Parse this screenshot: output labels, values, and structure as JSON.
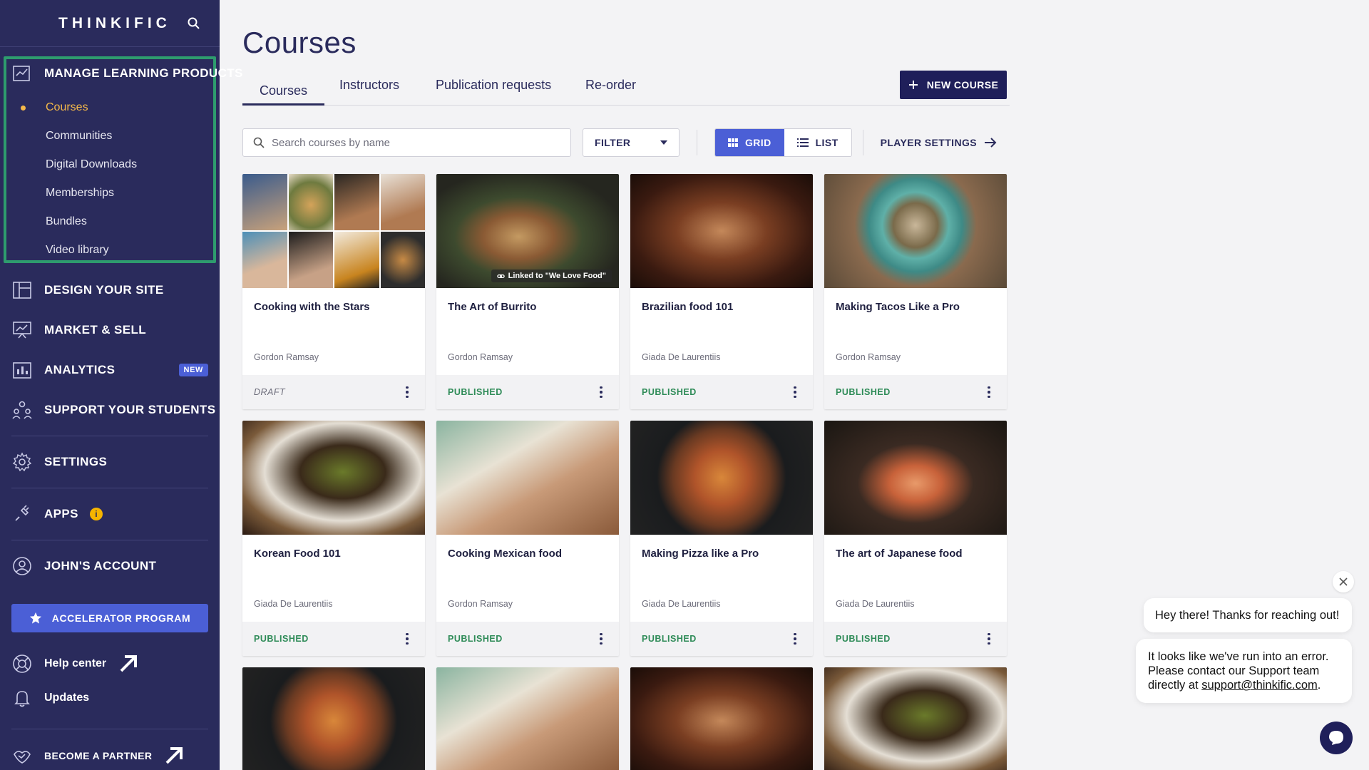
{
  "sidebar": {
    "logo": "THINKIFIC",
    "sections": {
      "manage": "MANAGE LEARNING PRODUCTS",
      "design": "DESIGN YOUR SITE",
      "market": "MARKET & SELL",
      "analytics": "ANALYTICS",
      "analytics_badge": "NEW",
      "support": "SUPPORT YOUR STUDENTS",
      "settings": "SETTINGS",
      "apps": "APPS",
      "apps_badge": "i",
      "account": "JOHN'S ACCOUNT"
    },
    "sub_items": [
      "Courses",
      "Communities",
      "Digital Downloads",
      "Memberships",
      "Bundles",
      "Video library"
    ],
    "accelerator": "ACCELERATOR PROGRAM",
    "help": "Help center",
    "updates": "Updates",
    "partner": "BECOME A PARTNER"
  },
  "page": {
    "title": "Courses",
    "tabs": [
      "Courses",
      "Instructors",
      "Publication requests",
      "Re-order"
    ],
    "new_course": "NEW COURSE"
  },
  "toolbar": {
    "search_placeholder": "Search courses by name",
    "filter": "FILTER",
    "grid": "GRID",
    "list": "LIST",
    "player_settings": "PLAYER SETTINGS"
  },
  "courses": [
    {
      "title": "Cooking with the Stars",
      "author": "Gordon Ramsay",
      "status": "DRAFT"
    },
    {
      "title": "The Art of Burrito",
      "author": "Gordon Ramsay",
      "status": "PUBLISHED",
      "chip": "Linked to \"We Love Food\""
    },
    {
      "title": "Brazilian food 101",
      "author": "Giada De Laurentiis",
      "status": "PUBLISHED"
    },
    {
      "title": "Making Tacos Like a Pro",
      "author": "Gordon Ramsay",
      "status": "PUBLISHED"
    },
    {
      "title": "Korean Food 101",
      "author": "Giada De Laurentiis",
      "status": "PUBLISHED"
    },
    {
      "title": "Cooking Mexican food",
      "author": "Gordon Ramsay",
      "status": "PUBLISHED"
    },
    {
      "title": "Making Pizza like a Pro",
      "author": "Giada De Laurentiis",
      "status": "PUBLISHED"
    },
    {
      "title": "The art of Japanese food",
      "author": "Giada De Laurentiis",
      "status": "PUBLISHED"
    }
  ],
  "chat": {
    "greeting": "Hey there! Thanks for reaching out!",
    "error_text": "It looks like we've run into an error. Please contact our Support team directly at ",
    "email": "support@thinkific.com",
    "error_end": "."
  },
  "colors": {
    "sidebar_bg": "#2a2b5c",
    "accent": "#4b5fd6",
    "active_sub": "#f5b94a",
    "highlight_box": "#2e9c6e",
    "published": "#2e8b57"
  }
}
